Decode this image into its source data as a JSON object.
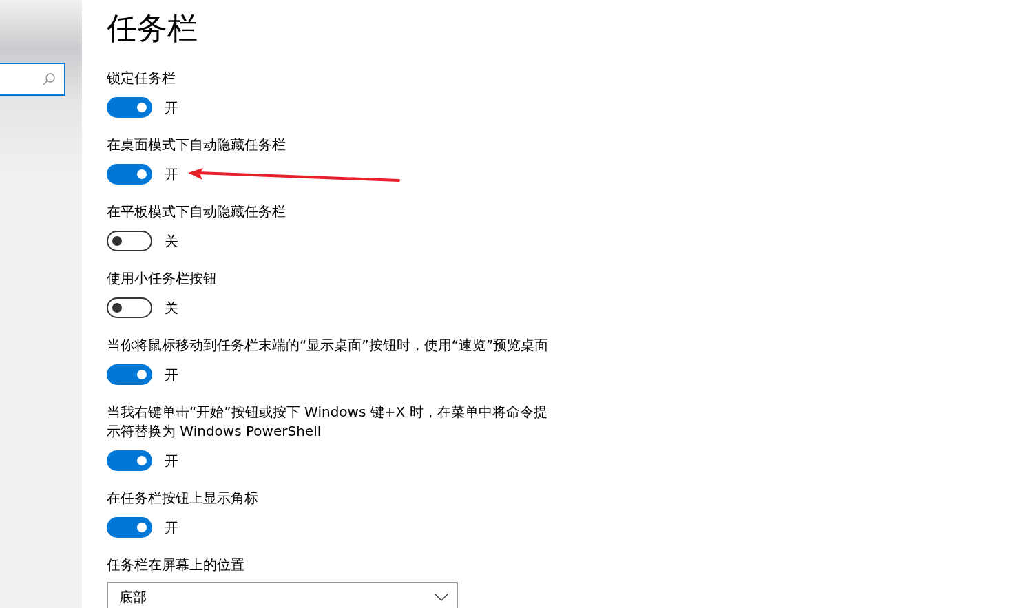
{
  "sidebar": {
    "search_field": {
      "focused": true
    }
  },
  "title": "任务栏",
  "settings": [
    {
      "kind": "toggle",
      "label": "锁定任务栏",
      "on": true,
      "state_text": "开"
    },
    {
      "kind": "toggle",
      "label": "在桌面模式下自动隐藏任务栏",
      "on": true,
      "state_text": "开"
    },
    {
      "kind": "toggle",
      "label": "在平板模式下自动隐藏任务栏",
      "on": false,
      "state_text": "关"
    },
    {
      "kind": "toggle",
      "label": "使用小任务栏按钮",
      "on": false,
      "state_text": "关"
    },
    {
      "kind": "toggle",
      "label": "当你将鼠标移动到任务栏末端的“显示桌面”按钮时，使用“速览”预览桌面",
      "on": true,
      "state_text": "开"
    },
    {
      "kind": "toggle",
      "label": "当我右键单击“开始”按钮或按下 Windows 键+X 时，在菜单中将命令提示符替换为 Windows PowerShell",
      "on": true,
      "state_text": "开"
    },
    {
      "kind": "toggle",
      "label": "在任务栏按钮上显示角标",
      "on": true,
      "state_text": "开"
    },
    {
      "kind": "dropdown",
      "label": "任务栏在屏幕上的位置",
      "value": "底部"
    }
  ]
}
